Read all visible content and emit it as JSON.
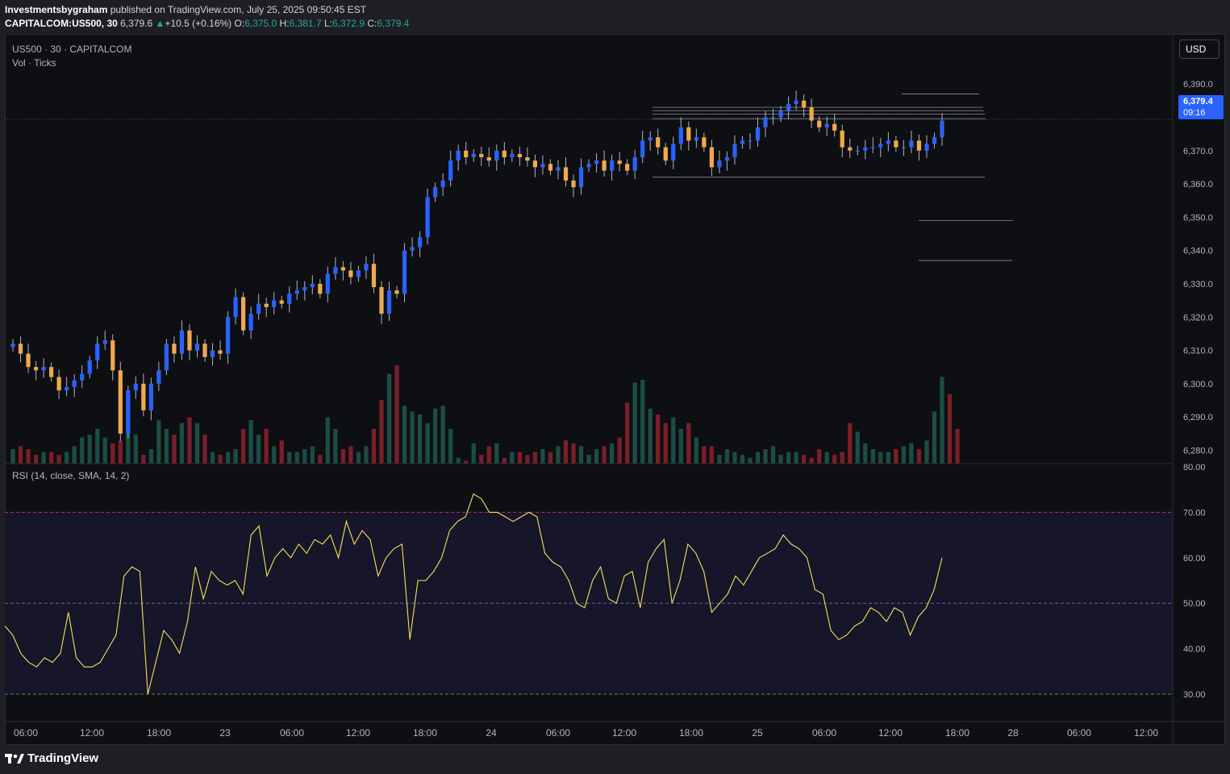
{
  "header": {
    "author": "Investmentsbygraham",
    "published_text": " published on TradingView.com, July 25, 2025 09:50:45 EST",
    "symbol": "CAPITALCOM:US500, 30",
    "last_price": "6,379.6",
    "change_arrow": "▲",
    "change": "+10.5 (+0.16%)",
    "o_label": "O:",
    "o_value": "6,375.0",
    "h_label": "H:",
    "h_value": "6,381.7",
    "l_label": "L:",
    "l_value": "6,372.9",
    "c_label": "C:",
    "c_value": "6,379.4"
  },
  "legend": {
    "main_symbol": "US500 · 30 · CAPITALCOM",
    "volume": "Vol · Ticks",
    "rsi": "RSI (14, close, SMA, 14, 2)"
  },
  "currency_button": "USD",
  "price_badge": {
    "price": "6,379.4",
    "countdown": "09:16"
  },
  "footer": {
    "brand": "TradingView"
  },
  "colors": {
    "background": "#0e0f13",
    "up_candle": "#2962ff",
    "down_candle": "#f0a94b",
    "volume_up": "#1b4e43",
    "volume_down": "#7a1f28",
    "rsi_line": "#f5e25a",
    "rsi_band": "#16152a",
    "overbought": "#c0344f",
    "oversold": "#3a9a45",
    "midline": "#6c6888"
  },
  "chart_data": {
    "type": "candlestick",
    "price_axis": {
      "range": [
        6276,
        6391
      ],
      "ticks": [
        "6,390.0",
        "6,370.0",
        "6,360.0",
        "6,350.0",
        "6,340.0",
        "6,330.0",
        "6,320.0",
        "6,310.0",
        "6,300.0",
        "6,290.0",
        "6,280.0"
      ]
    },
    "time_axis": {
      "ticks": [
        "06:00",
        "12:00",
        "18:00",
        "23",
        "06:00",
        "12:00",
        "18:00",
        "24",
        "06:00",
        "12:00",
        "18:00",
        "25",
        "06:00",
        "12:00",
        "18:00",
        "28",
        "06:00",
        "12:00"
      ]
    },
    "candles_path": [
      6312,
      6309,
      6305,
      6304,
      6305,
      6302,
      6298,
      6299,
      6301,
      6303,
      6307,
      6312,
      6313,
      6304,
      6285,
      6298,
      6300,
      6292,
      6300,
      6304,
      6312,
      6309,
      6316,
      6310,
      6312,
      6308,
      6310,
      6309,
      6320,
      6326,
      6316,
      6321,
      6324,
      6323,
      6325,
      6324,
      6327,
      6328,
      6329,
      6330,
      6327,
      6333,
      6335,
      6334,
      6332,
      6334,
      6336,
      6329,
      6321,
      6328,
      6327,
      6340,
      6341,
      6344,
      6356,
      6359,
      6361,
      6367,
      6370,
      6368,
      6369,
      6368,
      6367,
      6370,
      6368,
      6369,
      6368,
      6367,
      6365,
      6366,
      6364,
      6365,
      6361,
      6359,
      6365,
      6366,
      6367,
      6364,
      6367,
      6366,
      6364,
      6368,
      6373,
      6374,
      6371,
      6367,
      6372,
      6377,
      6373,
      6374,
      6371,
      6365,
      6367,
      6368,
      6372,
      6373,
      6373,
      6377,
      6380,
      6380,
      6382,
      6384,
      6385,
      6383,
      6379,
      6377,
      6378,
      6376,
      6371,
      6370,
      6370,
      6371,
      6371,
      6372,
      6373,
      6371,
      6371,
      6373,
      6370,
      6372,
      6374,
      6379
    ],
    "volume_ticks": [
      5,
      6,
      5,
      3,
      4,
      4,
      3,
      4,
      6,
      9,
      10,
      12,
      9,
      7,
      8,
      11,
      10,
      3,
      5,
      15,
      12,
      10,
      14,
      16,
      14,
      10,
      4,
      3,
      4,
      5,
      12,
      15,
      10,
      12,
      6,
      8,
      4,
      4,
      5,
      6,
      3,
      16,
      12,
      5,
      6,
      4,
      6,
      12,
      22,
      31,
      34,
      20,
      18,
      17,
      14,
      19,
      20,
      12,
      2,
      1,
      7,
      3,
      6,
      7,
      2,
      4,
      4,
      3,
      4,
      5,
      4,
      6,
      8,
      7,
      6,
      3,
      5,
      6,
      7,
      9,
      21,
      28,
      29,
      19,
      17,
      14,
      16,
      12,
      14,
      9,
      6,
      6,
      3,
      5,
      4,
      3,
      2,
      4,
      5,
      6,
      3,
      4,
      4,
      3,
      2,
      5,
      4,
      3,
      4,
      14,
      11,
      7,
      5,
      4,
      4,
      5,
      6,
      7,
      5,
      8,
      18,
      30,
      24,
      12
    ],
    "rsi": {
      "range": [
        25,
        82
      ],
      "ticks": [
        "80.00",
        "70.00",
        "60.00",
        "50.00",
        "40.00",
        "30.00"
      ],
      "levels": [
        70,
        50,
        30
      ],
      "values": [
        45,
        43,
        39,
        37,
        36,
        38,
        37,
        39,
        48,
        38,
        36,
        36,
        37,
        40,
        43,
        56,
        58,
        57,
        30,
        37,
        44,
        42,
        39,
        46,
        58,
        51,
        57,
        55,
        54,
        55,
        52,
        65,
        67,
        56,
        60,
        62,
        60,
        63,
        61,
        64,
        63,
        65,
        60,
        68,
        63,
        66,
        64,
        56,
        60,
        62,
        63,
        42,
        55,
        55,
        57,
        60,
        66,
        68,
        69,
        74,
        73,
        70,
        70,
        69,
        68,
        69,
        70,
        69,
        61,
        59,
        58,
        55,
        50,
        49,
        55,
        58,
        51,
        50,
        56,
        57,
        49,
        59,
        62,
        64,
        50,
        55,
        63,
        61,
        57,
        48,
        50,
        52,
        56,
        54,
        57,
        60,
        61,
        62,
        65,
        63,
        62,
        60,
        53,
        52,
        44,
        42,
        43,
        45,
        46,
        49,
        48,
        46,
        49,
        48,
        43,
        47,
        49,
        53,
        60
      ]
    },
    "annotation_lines": true
  }
}
